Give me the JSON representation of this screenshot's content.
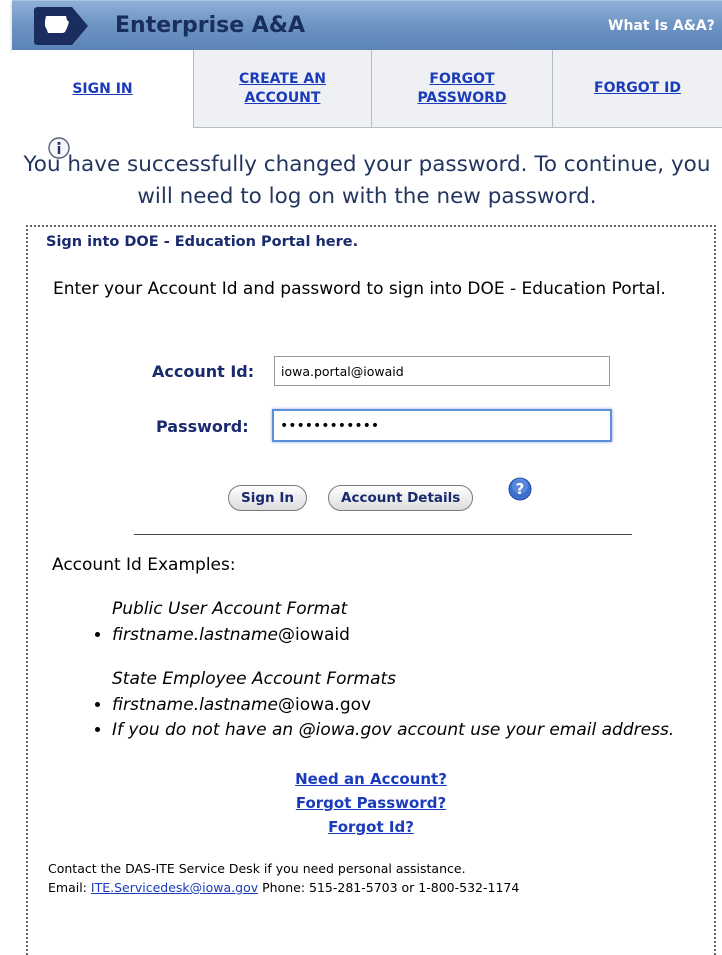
{
  "header": {
    "logo_icon": "iowa-state-outline-icon",
    "title": "Enterprise A&A",
    "what_is_link": "What Is A&A?"
  },
  "tabs": [
    {
      "label": "SIGN IN",
      "active": true
    },
    {
      "label_line1": "CREATE AN",
      "label_line2": "ACCOUNT"
    },
    {
      "label_line1": "FORGOT",
      "label_line2": "PASSWORD"
    },
    {
      "label": "FORGOT ID"
    }
  ],
  "message": {
    "icon": "info-icon",
    "text": "You have successfully changed your password. To continue, you will need to log on with the new password."
  },
  "panel": {
    "title": "Sign into DOE - Education Portal here.",
    "intro": "Enter your Account Id and password to sign into DOE - Education Portal."
  },
  "form": {
    "account_label": "Account Id:",
    "account_value": "iowa.portal@iowaid",
    "password_label": "Password:",
    "password_value": "••••••••••••",
    "sign_in_button": "Sign In",
    "account_details_button": "Account Details",
    "help_icon": "question-mark-icon"
  },
  "examples": {
    "title": "Account Id Examples:",
    "public_heading": "Public User Account Format",
    "public_example_italic": "firstname.lastname",
    "public_example_suffix": "@iowaid",
    "state_heading": "State Employee Account Formats",
    "state_example_italic": "firstname.lastname",
    "state_example_suffix": "@iowa.gov",
    "state_note": "If you do not have an @iowa.gov account use your email address."
  },
  "links": {
    "need_account": "Need an Account?",
    "forgot_password": "Forgot Password?",
    "forgot_id": "Forgot Id?"
  },
  "contact": {
    "line1": "Contact the DAS-ITE Service Desk if you need personal assistance.",
    "email_label": "Email:",
    "email": "ITE.Servicedesk@iowa.gov",
    "phone": "Phone: 515-281-5703 or 1-800-532-1174"
  }
}
